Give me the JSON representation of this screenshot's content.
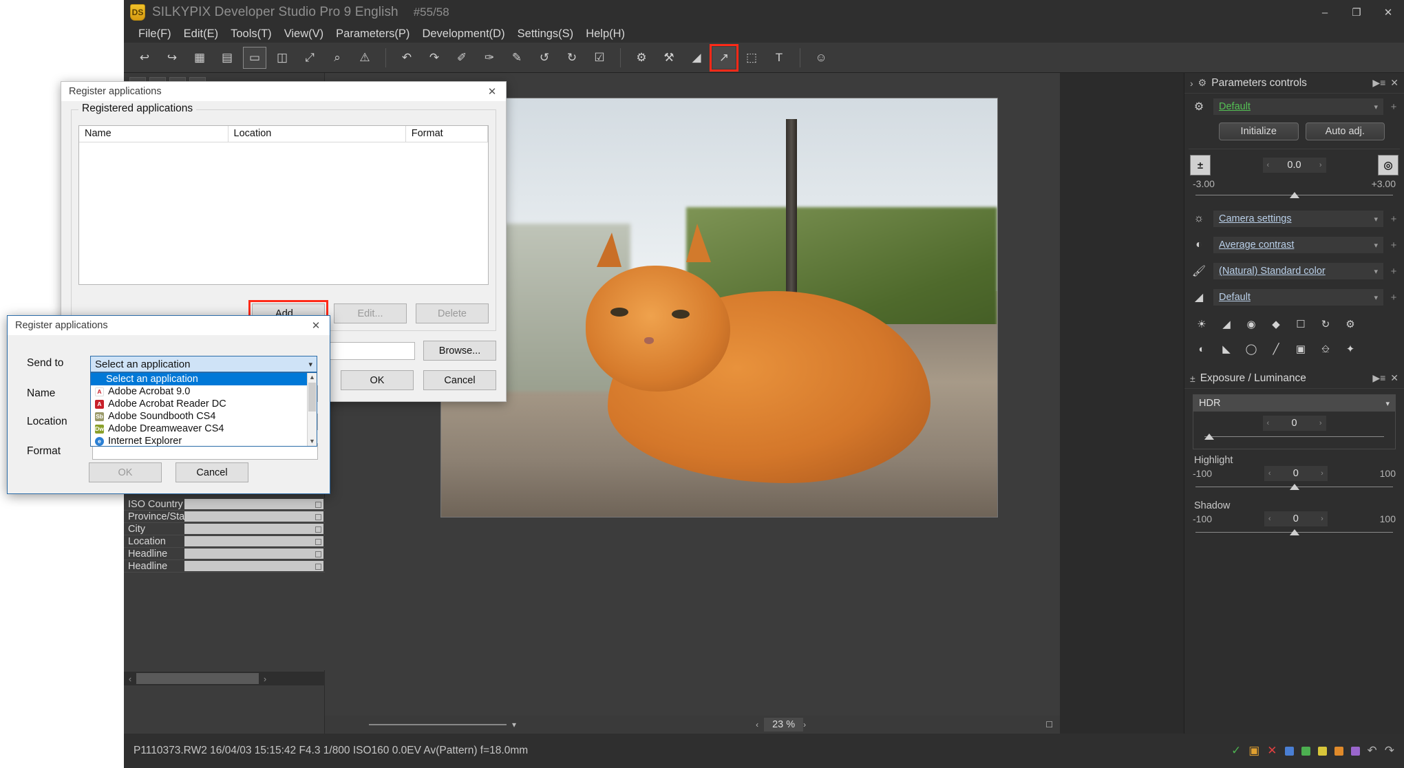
{
  "window": {
    "app_icon_text": "DS",
    "title": "SILKYPIX Developer Studio Pro 9 English",
    "counter": "#55/58",
    "minimize": "–",
    "maximize": "❐",
    "close": "✕"
  },
  "menubar": {
    "items": [
      {
        "label": "File(F)"
      },
      {
        "label": "Edit(E)"
      },
      {
        "label": "Tools(T)"
      },
      {
        "label": "View(V)"
      },
      {
        "label": "Parameters(P)"
      },
      {
        "label": "Development(D)"
      },
      {
        "label": "Settings(S)"
      },
      {
        "label": "Help(H)"
      }
    ]
  },
  "toolbar": {
    "buttons": [
      {
        "name": "back-arrow-icon",
        "glyph": "↩"
      },
      {
        "name": "forward-arrow-icon",
        "glyph": "↪"
      },
      {
        "name": "grid-view-icon",
        "glyph": "▦"
      },
      {
        "name": "list-view-icon",
        "glyph": "▤"
      },
      {
        "name": "single-view-icon",
        "glyph": "▭"
      },
      {
        "name": "compare-view-icon",
        "glyph": "◫"
      },
      {
        "name": "fullscreen-icon",
        "glyph": "⤢"
      },
      {
        "name": "magnifier-icon",
        "glyph": "⌕"
      },
      {
        "name": "warning-icon",
        "glyph": "⚠"
      },
      {
        "name": "undo-icon",
        "glyph": "↶"
      },
      {
        "name": "redo-icon",
        "glyph": "↷"
      },
      {
        "name": "copy-params-icon",
        "glyph": "✐"
      },
      {
        "name": "paste-params-icon",
        "glyph": "✑"
      },
      {
        "name": "edit-params-icon",
        "glyph": "✎"
      },
      {
        "name": "rotate-left-icon",
        "glyph": "↺"
      },
      {
        "name": "rotate-right-icon",
        "glyph": "↻"
      },
      {
        "name": "check-mark-icon",
        "glyph": "☑"
      },
      {
        "name": "develop-batch-icon",
        "glyph": "⚙"
      },
      {
        "name": "develop-icon",
        "glyph": "⚒"
      },
      {
        "name": "eraser-icon",
        "glyph": "◢"
      },
      {
        "name": "send-to-app-icon",
        "glyph": "↗"
      },
      {
        "name": "print-icon",
        "glyph": "⬚"
      },
      {
        "name": "text-tool-icon",
        "glyph": "T"
      },
      {
        "name": "face-detect-icon",
        "glyph": "☺"
      }
    ]
  },
  "viewer": {
    "zoom_value": "23",
    "zoom_unit": "%"
  },
  "metadata_panel": {
    "rows": [
      {
        "label": "ISO Country C"
      },
      {
        "label": "Province/State"
      },
      {
        "label": "City"
      },
      {
        "label": "Location"
      },
      {
        "label": "Headline"
      },
      {
        "label": "Headline"
      }
    ]
  },
  "right_panel": {
    "parameters_controls": {
      "title": "Parameters controls",
      "menu_icon": "▶≡",
      "close_icon": "✕",
      "expand_icon": "›",
      "preset_value": "Default",
      "initialize_label": "Initialize",
      "auto_adj_label": "Auto adj.",
      "exposure_value": "0.0",
      "exposure_min": "-3.00",
      "exposure_max": "+3.00",
      "combos": [
        {
          "icon": "sun-icon",
          "value": "Camera settings"
        },
        {
          "icon": "contrast-icon",
          "value": "Average contrast"
        },
        {
          "icon": "color-icon",
          "value": "(Natural) Standard color"
        },
        {
          "icon": "sharpness-icon",
          "value": "Default"
        }
      ],
      "tool_icons_row1": [
        "white-balance-icon",
        "tone-curve-icon",
        "noise-icon",
        "sharpen-icon",
        "crop-tool-icon",
        "rotate-tool-icon",
        "settings-icon"
      ],
      "tool_icons_row2": [
        "dodge-icon",
        "gradient-icon",
        "lens-icon",
        "brush-icon",
        "spot-icon",
        "crop-icon",
        "effects-icon"
      ]
    },
    "exposure_luminance": {
      "title": "Exposure / Luminance",
      "menu_icon": "▶≡",
      "close_icon": "✕",
      "hdr_label": "HDR",
      "hdr_value": "0",
      "highlight_label": "Highlight",
      "highlight_value": "0",
      "highlight_min": "-100",
      "highlight_max": "100",
      "shadow_label": "Shadow",
      "shadow_value": "0",
      "shadow_min": "-100",
      "shadow_max": "100"
    }
  },
  "statusbar": {
    "text": "P1110373.RW2 16/04/03 15:15:42 F4.3 1/800 ISO160  0.0EV Av(Pattern) f=18.0mm",
    "icons": [
      {
        "name": "check-icon",
        "glyph": "✓",
        "color": "#4caf50"
      },
      {
        "name": "folder-icon",
        "glyph": "▣",
        "color": "#e0a030"
      },
      {
        "name": "delete-icon",
        "glyph": "✕",
        "color": "#e04040"
      },
      {
        "name": "rating-blue-icon",
        "color": "#4a7fd4"
      },
      {
        "name": "rating-green-icon",
        "color": "#4caf50"
      },
      {
        "name": "rating-yellow-icon",
        "color": "#d8c63a"
      },
      {
        "name": "rating-orange-icon",
        "color": "#e08a2a"
      },
      {
        "name": "rating-violet-icon",
        "color": "#9a66cc"
      },
      {
        "name": "undo-status-icon",
        "glyph": "↶",
        "color": "#b0b0b0"
      },
      {
        "name": "redo-status-icon",
        "glyph": "↷",
        "color": "#b0b0b0"
      }
    ]
  },
  "dialog_register": {
    "title": "Register applications",
    "close_icon": "✕",
    "group_legend": "Registered applications",
    "columns": [
      "Name",
      "Location",
      "Format"
    ],
    "rows": [],
    "add_label": "Add...",
    "edit_label": "Edit...",
    "delete_label": "Delete",
    "browse_label": "Browse...",
    "ok_label": "OK",
    "cancel_label": "Cancel"
  },
  "dialog_add": {
    "title": "Register applications",
    "close_icon": "✕",
    "fields": [
      {
        "label": "Send to"
      },
      {
        "label": "Name"
      },
      {
        "label": "Location"
      },
      {
        "label": "Format"
      }
    ],
    "combo_value": "Select an application",
    "options": [
      {
        "label": "Select an application",
        "selected": true,
        "icon_text": "",
        "icon_color": ""
      },
      {
        "label": "Adobe Acrobat 9.0",
        "selected": false,
        "icon_text": "A",
        "icon_color": "#ffffff"
      },
      {
        "label": "Adobe Acrobat Reader DC",
        "selected": false,
        "icon_text": "A",
        "icon_color": "#c8202a"
      },
      {
        "label": "Adobe Soundbooth CS4",
        "selected": false,
        "icon_text": "Sb",
        "icon_color": "#9a9a6a"
      },
      {
        "label": "Adobe Dreamweaver CS4",
        "selected": false,
        "icon_text": "Dw",
        "icon_color": "#8aa02a"
      },
      {
        "label": "Internet Explorer",
        "selected": false,
        "icon_text": "e",
        "icon_color": "#2a7fd4"
      }
    ],
    "ok_label": "OK",
    "cancel_label": "Cancel",
    "scroll_up": "▲",
    "scroll_down": "▼"
  },
  "colors": {
    "highlight_red": "#ff2a18",
    "selection_blue": "#0078d7",
    "accent_green": "#54c054"
  }
}
